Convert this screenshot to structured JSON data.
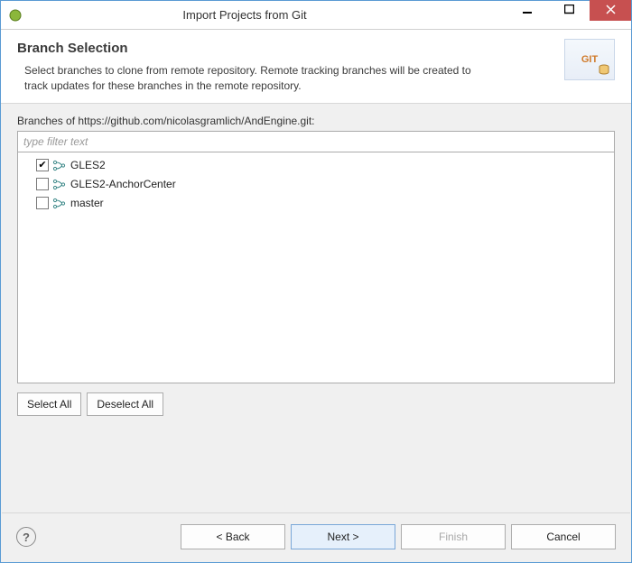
{
  "window": {
    "title": "Import Projects from Git"
  },
  "header": {
    "title": "Branch Selection",
    "description": "Select branches to clone from remote repository. Remote tracking branches will be created to track updates for these branches in the remote repository.",
    "icon_label": "GIT"
  },
  "branches_label": "Branches of https://github.com/nicolasgramlich/AndEngine.git:",
  "filter_placeholder": "type filter text",
  "branches": [
    {
      "name": "GLES2",
      "checked": true
    },
    {
      "name": "GLES2-AnchorCenter",
      "checked": false
    },
    {
      "name": "master",
      "checked": false
    }
  ],
  "buttons": {
    "select_all": "Select All",
    "deselect_all": "Deselect All",
    "back": "< Back",
    "next": "Next >",
    "finish": "Finish",
    "cancel": "Cancel"
  }
}
